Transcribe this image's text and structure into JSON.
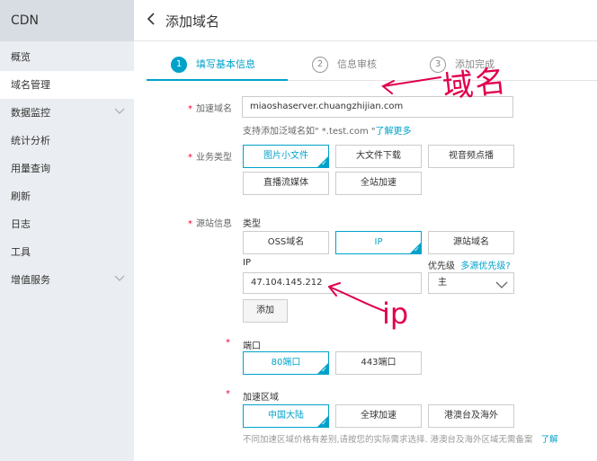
{
  "sidebar": {
    "title": "CDN",
    "items": [
      {
        "label": "概览"
      },
      {
        "label": "域名管理"
      },
      {
        "label": "数据监控"
      },
      {
        "label": "统计分析"
      },
      {
        "label": "用量查询"
      },
      {
        "label": "刷新"
      },
      {
        "label": "日志"
      },
      {
        "label": "工具"
      },
      {
        "label": "增值服务"
      }
    ]
  },
  "header": {
    "back": "‹",
    "title": "添加域名"
  },
  "steps": [
    {
      "num": "1",
      "label": "填写基本信息"
    },
    {
      "num": "2",
      "label": "信息审核"
    },
    {
      "num": "3",
      "label": "添加完成"
    }
  ],
  "form": {
    "domain_label": "加速域名",
    "domain_value": "miaoshaserver.chuangzhijian.com",
    "domain_help": "支持添加泛域名如\" *.test.com \"",
    "domain_help_link": "了解更多",
    "business_label": "业务类型",
    "business_options": [
      "图片小文件",
      "大文件下载",
      "视音频点播",
      "直播流媒体",
      "全站加速"
    ],
    "origin_label": "源站信息",
    "origin_type_label": "类型",
    "origin_types": [
      "OSS域名",
      "IP",
      "源站域名"
    ],
    "ip_label": "IP",
    "ip_value": "47.104.145.212",
    "priority_label": "优先级",
    "priority_link": "多源优先级?",
    "priority_value": "主",
    "add_button": "添加",
    "port_label": "端口",
    "ports": [
      "80端口",
      "443端口"
    ],
    "region_label": "加速区域",
    "regions": [
      "中国大陆",
      "全球加速",
      "港澳台及海外"
    ],
    "region_note": "不同加速区域价格有差别,请按您的实际需求选择. 港澳台及海外区域无需备案",
    "region_note_link": "了解"
  },
  "annotations": {
    "domain": "域名",
    "ip": "ip"
  },
  "colors": {
    "accent": "#00a2ca",
    "sidebar_bg": "#eaedf1",
    "required": "#e03"
  }
}
